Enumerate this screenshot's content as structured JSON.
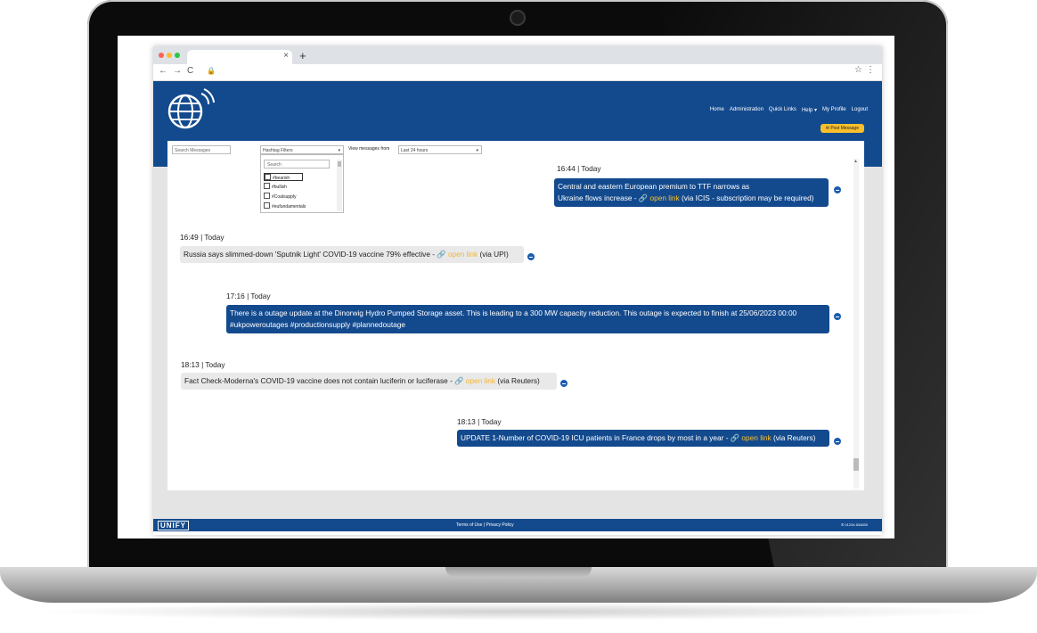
{
  "browser": {
    "tab_close": "×",
    "new_tab": "+",
    "nav_back": "←",
    "nav_forward": "→",
    "nav_reload": "C",
    "lock_icon": "🔒",
    "star_icon": "☆",
    "menu_icon": "⋮"
  },
  "nav": {
    "items": [
      "Home",
      "Administration",
      "Quick Links",
      "Help ▾",
      "My Profile",
      "Logout"
    ]
  },
  "post_button": "✉ Post Message",
  "filters": {
    "search_placeholder": "Search Messages",
    "hashtag_label": "Hashtag Filters",
    "view_from_label": "View messages from",
    "time_value": "Last 24 hours",
    "dropdown_search": "Search",
    "dropdown_items": [
      "#bearish",
      "#bullish",
      "#Coalsupply",
      "#eufundamentals"
    ]
  },
  "messages": [
    {
      "time": "16:44 | Today",
      "line1": "Central and eastern European premium to TTF narrows as",
      "line2": "Ukraine flows increase - ",
      "link": "🔗 open link",
      "suffix": " (via ICIS - subscription may be required)",
      "style": "blue"
    },
    {
      "time": "16:49 | Today",
      "text": "Russia says slimmed-down 'Sputnik Light' COVID-19 vaccine 79% effective - ",
      "link": "🔗 open link",
      "suffix": " (via UPI)",
      "style": "grey"
    },
    {
      "time": "17:16 | Today",
      "line1": "There is a outage update at the Dinorwig Hydro Pumped Storage asset. This is leading to a 300 MW capacity reduction. This outage is expected to finish at 25/06/2023 00:00",
      "line2": "#ukpoweroutages  #productionsupply  #plannedoutage",
      "style": "blue"
    },
    {
      "time": "18:13 | Today",
      "text": "Fact Check-Moderna's COVID-19 vaccine does not contain luciferin or luciferase - ",
      "link": "🔗 open link",
      "suffix": " (via Reuters)",
      "style": "grey"
    },
    {
      "time": "18:13 | Today",
      "text": "UPDATE 1-Number of COVID-19 ICU patients in France drops by most in a year - ",
      "link": "🔗 open link",
      "suffix": " (via Reuters)",
      "style": "blue"
    }
  ],
  "footer": {
    "brand": "UNIFY",
    "terms": "Terms of Use",
    "separator": "|",
    "privacy": "Privacy Policy",
    "phone": "✆ 01234 834830"
  },
  "colors": {
    "primary": "#134a8e",
    "accent": "#f9c02b",
    "bubble_grey": "#e9e9e9"
  }
}
